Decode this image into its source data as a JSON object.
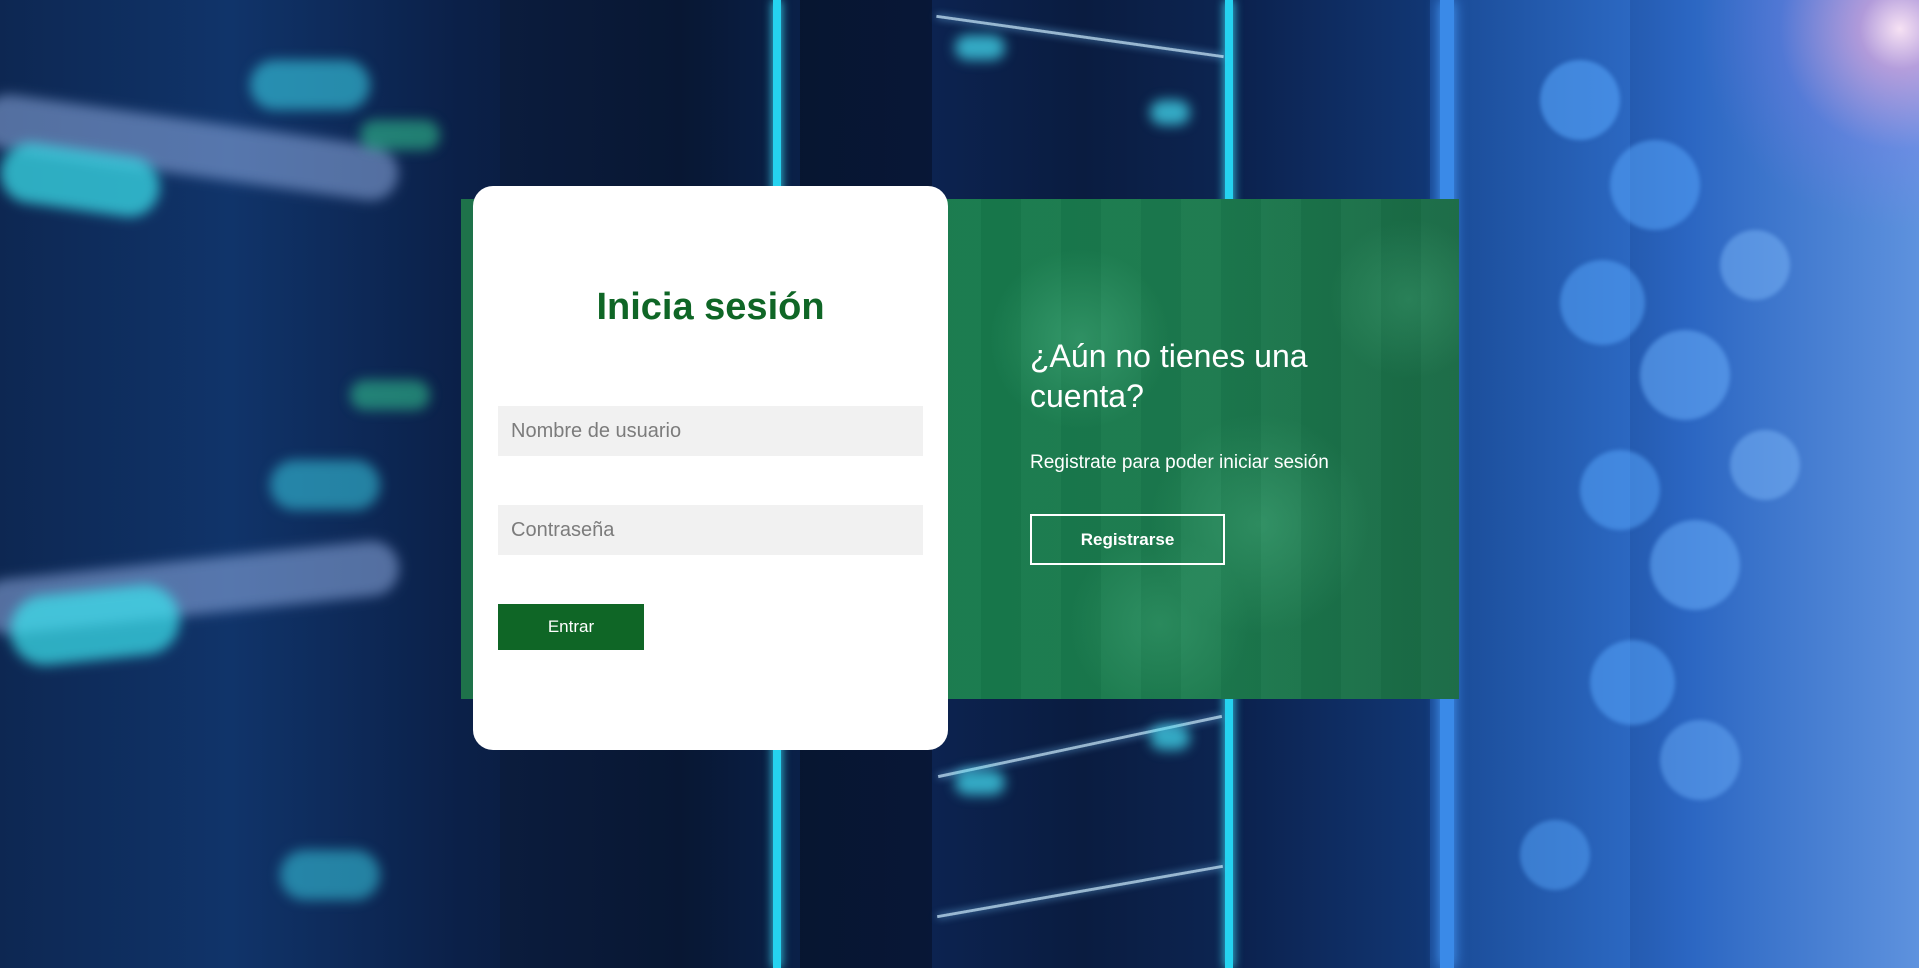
{
  "login": {
    "title": "Inicia sesión",
    "username_placeholder": "Nombre de usuario",
    "password_placeholder": "Contraseña",
    "submit_label": "Entrar"
  },
  "register": {
    "heading": "¿Aún no tienes una cuenta?",
    "subtext": "Registrate para poder iniciar sesión",
    "button_label": "Registrarse"
  },
  "colors": {
    "brand_green": "#0f6626",
    "panel_green": "#1a6f46",
    "field_bg": "#f1f1f1"
  }
}
